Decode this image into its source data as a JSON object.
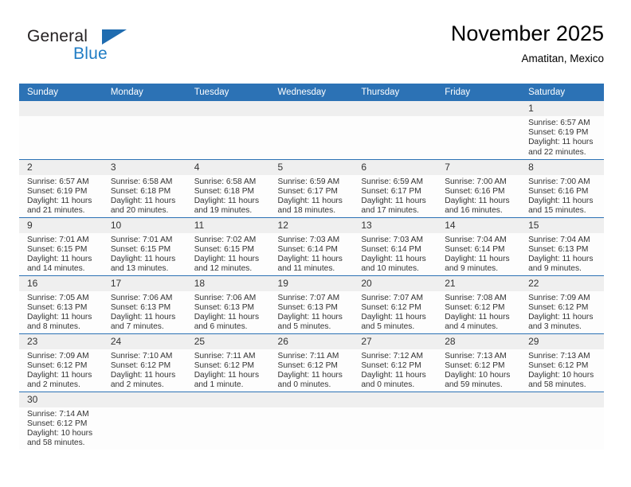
{
  "logo": {
    "word1": "General",
    "word2": "Blue",
    "triangle_color": "#1f6cb0",
    "blue_color": "#1f7cc4"
  },
  "header": {
    "title": "November 2025",
    "subtitle": "Amatitan, Mexico"
  },
  "theme": {
    "header_bg": "#2c72b5",
    "daynum_bg": "#efefef",
    "row_divider": "#2c72b5",
    "text": "#333333"
  },
  "weekday_headers": [
    "Sunday",
    "Monday",
    "Tuesday",
    "Wednesday",
    "Thursday",
    "Friday",
    "Saturday"
  ],
  "labels": {
    "sunrise": "Sunrise:",
    "sunset": "Sunset:",
    "daylight": "Daylight:"
  },
  "weeks": [
    [
      {
        "day": "",
        "empty": true
      },
      {
        "day": "",
        "empty": true
      },
      {
        "day": "",
        "empty": true
      },
      {
        "day": "",
        "empty": true
      },
      {
        "day": "",
        "empty": true
      },
      {
        "day": "",
        "empty": true
      },
      {
        "day": "1",
        "sunrise": "Sunrise: 6:57 AM",
        "sunset": "Sunset: 6:19 PM",
        "daylight1": "Daylight: 11 hours",
        "daylight2": "and 22 minutes."
      }
    ],
    [
      {
        "day": "2",
        "sunrise": "Sunrise: 6:57 AM",
        "sunset": "Sunset: 6:19 PM",
        "daylight1": "Daylight: 11 hours",
        "daylight2": "and 21 minutes."
      },
      {
        "day": "3",
        "sunrise": "Sunrise: 6:58 AM",
        "sunset": "Sunset: 6:18 PM",
        "daylight1": "Daylight: 11 hours",
        "daylight2": "and 20 minutes."
      },
      {
        "day": "4",
        "sunrise": "Sunrise: 6:58 AM",
        "sunset": "Sunset: 6:18 PM",
        "daylight1": "Daylight: 11 hours",
        "daylight2": "and 19 minutes."
      },
      {
        "day": "5",
        "sunrise": "Sunrise: 6:59 AM",
        "sunset": "Sunset: 6:17 PM",
        "daylight1": "Daylight: 11 hours",
        "daylight2": "and 18 minutes."
      },
      {
        "day": "6",
        "sunrise": "Sunrise: 6:59 AM",
        "sunset": "Sunset: 6:17 PM",
        "daylight1": "Daylight: 11 hours",
        "daylight2": "and 17 minutes."
      },
      {
        "day": "7",
        "sunrise": "Sunrise: 7:00 AM",
        "sunset": "Sunset: 6:16 PM",
        "daylight1": "Daylight: 11 hours",
        "daylight2": "and 16 minutes."
      },
      {
        "day": "8",
        "sunrise": "Sunrise: 7:00 AM",
        "sunset": "Sunset: 6:16 PM",
        "daylight1": "Daylight: 11 hours",
        "daylight2": "and 15 minutes."
      }
    ],
    [
      {
        "day": "9",
        "sunrise": "Sunrise: 7:01 AM",
        "sunset": "Sunset: 6:15 PM",
        "daylight1": "Daylight: 11 hours",
        "daylight2": "and 14 minutes."
      },
      {
        "day": "10",
        "sunrise": "Sunrise: 7:01 AM",
        "sunset": "Sunset: 6:15 PM",
        "daylight1": "Daylight: 11 hours",
        "daylight2": "and 13 minutes."
      },
      {
        "day": "11",
        "sunrise": "Sunrise: 7:02 AM",
        "sunset": "Sunset: 6:15 PM",
        "daylight1": "Daylight: 11 hours",
        "daylight2": "and 12 minutes."
      },
      {
        "day": "12",
        "sunrise": "Sunrise: 7:03 AM",
        "sunset": "Sunset: 6:14 PM",
        "daylight1": "Daylight: 11 hours",
        "daylight2": "and 11 minutes."
      },
      {
        "day": "13",
        "sunrise": "Sunrise: 7:03 AM",
        "sunset": "Sunset: 6:14 PM",
        "daylight1": "Daylight: 11 hours",
        "daylight2": "and 10 minutes."
      },
      {
        "day": "14",
        "sunrise": "Sunrise: 7:04 AM",
        "sunset": "Sunset: 6:14 PM",
        "daylight1": "Daylight: 11 hours",
        "daylight2": "and 9 minutes."
      },
      {
        "day": "15",
        "sunrise": "Sunrise: 7:04 AM",
        "sunset": "Sunset: 6:13 PM",
        "daylight1": "Daylight: 11 hours",
        "daylight2": "and 9 minutes."
      }
    ],
    [
      {
        "day": "16",
        "sunrise": "Sunrise: 7:05 AM",
        "sunset": "Sunset: 6:13 PM",
        "daylight1": "Daylight: 11 hours",
        "daylight2": "and 8 minutes."
      },
      {
        "day": "17",
        "sunrise": "Sunrise: 7:06 AM",
        "sunset": "Sunset: 6:13 PM",
        "daylight1": "Daylight: 11 hours",
        "daylight2": "and 7 minutes."
      },
      {
        "day": "18",
        "sunrise": "Sunrise: 7:06 AM",
        "sunset": "Sunset: 6:13 PM",
        "daylight1": "Daylight: 11 hours",
        "daylight2": "and 6 minutes."
      },
      {
        "day": "19",
        "sunrise": "Sunrise: 7:07 AM",
        "sunset": "Sunset: 6:13 PM",
        "daylight1": "Daylight: 11 hours",
        "daylight2": "and 5 minutes."
      },
      {
        "day": "20",
        "sunrise": "Sunrise: 7:07 AM",
        "sunset": "Sunset: 6:12 PM",
        "daylight1": "Daylight: 11 hours",
        "daylight2": "and 5 minutes."
      },
      {
        "day": "21",
        "sunrise": "Sunrise: 7:08 AM",
        "sunset": "Sunset: 6:12 PM",
        "daylight1": "Daylight: 11 hours",
        "daylight2": "and 4 minutes."
      },
      {
        "day": "22",
        "sunrise": "Sunrise: 7:09 AM",
        "sunset": "Sunset: 6:12 PM",
        "daylight1": "Daylight: 11 hours",
        "daylight2": "and 3 minutes."
      }
    ],
    [
      {
        "day": "23",
        "sunrise": "Sunrise: 7:09 AM",
        "sunset": "Sunset: 6:12 PM",
        "daylight1": "Daylight: 11 hours",
        "daylight2": "and 2 minutes."
      },
      {
        "day": "24",
        "sunrise": "Sunrise: 7:10 AM",
        "sunset": "Sunset: 6:12 PM",
        "daylight1": "Daylight: 11 hours",
        "daylight2": "and 2 minutes."
      },
      {
        "day": "25",
        "sunrise": "Sunrise: 7:11 AM",
        "sunset": "Sunset: 6:12 PM",
        "daylight1": "Daylight: 11 hours",
        "daylight2": "and 1 minute."
      },
      {
        "day": "26",
        "sunrise": "Sunrise: 7:11 AM",
        "sunset": "Sunset: 6:12 PM",
        "daylight1": "Daylight: 11 hours",
        "daylight2": "and 0 minutes."
      },
      {
        "day": "27",
        "sunrise": "Sunrise: 7:12 AM",
        "sunset": "Sunset: 6:12 PM",
        "daylight1": "Daylight: 11 hours",
        "daylight2": "and 0 minutes."
      },
      {
        "day": "28",
        "sunrise": "Sunrise: 7:13 AM",
        "sunset": "Sunset: 6:12 PM",
        "daylight1": "Daylight: 10 hours",
        "daylight2": "and 59 minutes."
      },
      {
        "day": "29",
        "sunrise": "Sunrise: 7:13 AM",
        "sunset": "Sunset: 6:12 PM",
        "daylight1": "Daylight: 10 hours",
        "daylight2": "and 58 minutes."
      }
    ],
    [
      {
        "day": "30",
        "sunrise": "Sunrise: 7:14 AM",
        "sunset": "Sunset: 6:12 PM",
        "daylight1": "Daylight: 10 hours",
        "daylight2": "and 58 minutes."
      },
      {
        "day": "",
        "void": true
      },
      {
        "day": "",
        "void": true
      },
      {
        "day": "",
        "void": true
      },
      {
        "day": "",
        "void": true
      },
      {
        "day": "",
        "void": true
      },
      {
        "day": "",
        "void": true
      }
    ]
  ]
}
